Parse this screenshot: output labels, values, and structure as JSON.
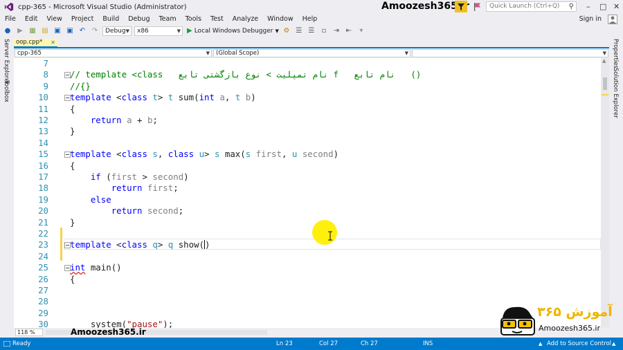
{
  "window": {
    "title": "cpp-365 - Microsoft Visual Studio (Administrator)",
    "brand_watermark": "Amoozesh365.ir",
    "quick_launch_placeholder": "Quick Launch (Ctrl+Q)",
    "sign_in": "Sign in"
  },
  "menu": [
    "File",
    "Edit",
    "View",
    "Project",
    "Build",
    "Debug",
    "Team",
    "Tools",
    "Test",
    "Analyze",
    "Window",
    "Help"
  ],
  "toolbar": {
    "config": "Debug",
    "platform": "x86",
    "run_label": "Local Windows Debugger"
  },
  "side_tabs": {
    "left": [
      "Server Explorer",
      "Toolbox"
    ],
    "right": [
      "Properties",
      "Solution Explorer"
    ]
  },
  "document_tab": {
    "name": "oop.cpp*"
  },
  "navbar": {
    "project": "cpp-365",
    "scope": "(Global Scope)",
    "member": ""
  },
  "code_lines": [
    {
      "n": "7",
      "html": ""
    },
    {
      "n": "8",
      "html": "<span class='cm'>// template &lt;class   نام تمپلیت &gt; نوع بازگشتی تابع f   نام تابع   ()</span>"
    },
    {
      "n": "9",
      "html": "<span class='cm'>//{}</span>"
    },
    {
      "n": "10",
      "html": "<span class='kw'>template</span> &lt;<span class='kw'>class</span> <span class='ty'>t</span>&gt; <span class='ty'>t</span> sum(<span class='kw'>int</span> <span class='par'>a</span>, <span class='ty'>t</span> <span class='par'>b</span>)"
    },
    {
      "n": "11",
      "html": "{"
    },
    {
      "n": "12",
      "html": "    <span class='kw'>return</span> <span class='par'>a</span> + <span class='par'>b</span>;"
    },
    {
      "n": "13",
      "html": "}"
    },
    {
      "n": "14",
      "html": ""
    },
    {
      "n": "15",
      "html": "<span class='kw'>template</span> &lt;<span class='kw'>class</span> <span class='ty'>s</span>, <span class='kw'>class</span> <span class='ty'>u</span>&gt; <span class='ty'>s</span> max(<span class='ty'>s</span> <span class='par'>first</span>, <span class='ty'>u</span> <span class='par'>second</span>)"
    },
    {
      "n": "16",
      "html": "{"
    },
    {
      "n": "17",
      "html": "    <span class='kw'>if</span> (<span class='par'>first</span> &gt; <span class='par'>second</span>)"
    },
    {
      "n": "18",
      "html": "        <span class='kw'>return</span> <span class='par'>first</span>;"
    },
    {
      "n": "19",
      "html": "    <span class='kw'>else</span>"
    },
    {
      "n": "20",
      "html": "        <span class='kw'>return</span> <span class='par'>second</span>;"
    },
    {
      "n": "21",
      "html": "}"
    },
    {
      "n": "22",
      "html": ""
    },
    {
      "n": "23",
      "html": "<span class='kw'>template</span> &lt;<span class='kw'>class</span> <span class='ty'>q</span>&gt; <span class='ty'>q</span> show(<span class='caret'></span>)"
    },
    {
      "n": "24",
      "html": ""
    },
    {
      "n": "25",
      "html": "<span class='kw squiggle'>int</span> main()"
    },
    {
      "n": "26",
      "html": "{"
    },
    {
      "n": "27",
      "html": ""
    },
    {
      "n": "28",
      "html": ""
    },
    {
      "n": "29",
      "html": ""
    },
    {
      "n": "30",
      "html": "    system(<span class='str'>\"pause\"</span>);"
    }
  ],
  "zoom": "118 %",
  "footer_watermark": "Amoozesh365.ir",
  "status": {
    "ready": "Ready",
    "line": "Ln 23",
    "col": "Col 27",
    "ch": "Ch 27",
    "mode": "INS",
    "source_control": "Add to Source Control"
  },
  "logo": {
    "persian": "آموزش ۳۶۵",
    "url": "Amoozesh365.ir"
  },
  "colors": {
    "accent": "#007acc",
    "keyword": "#0000ff",
    "type": "#2b91af",
    "comment": "#008000",
    "string": "#a31515"
  }
}
